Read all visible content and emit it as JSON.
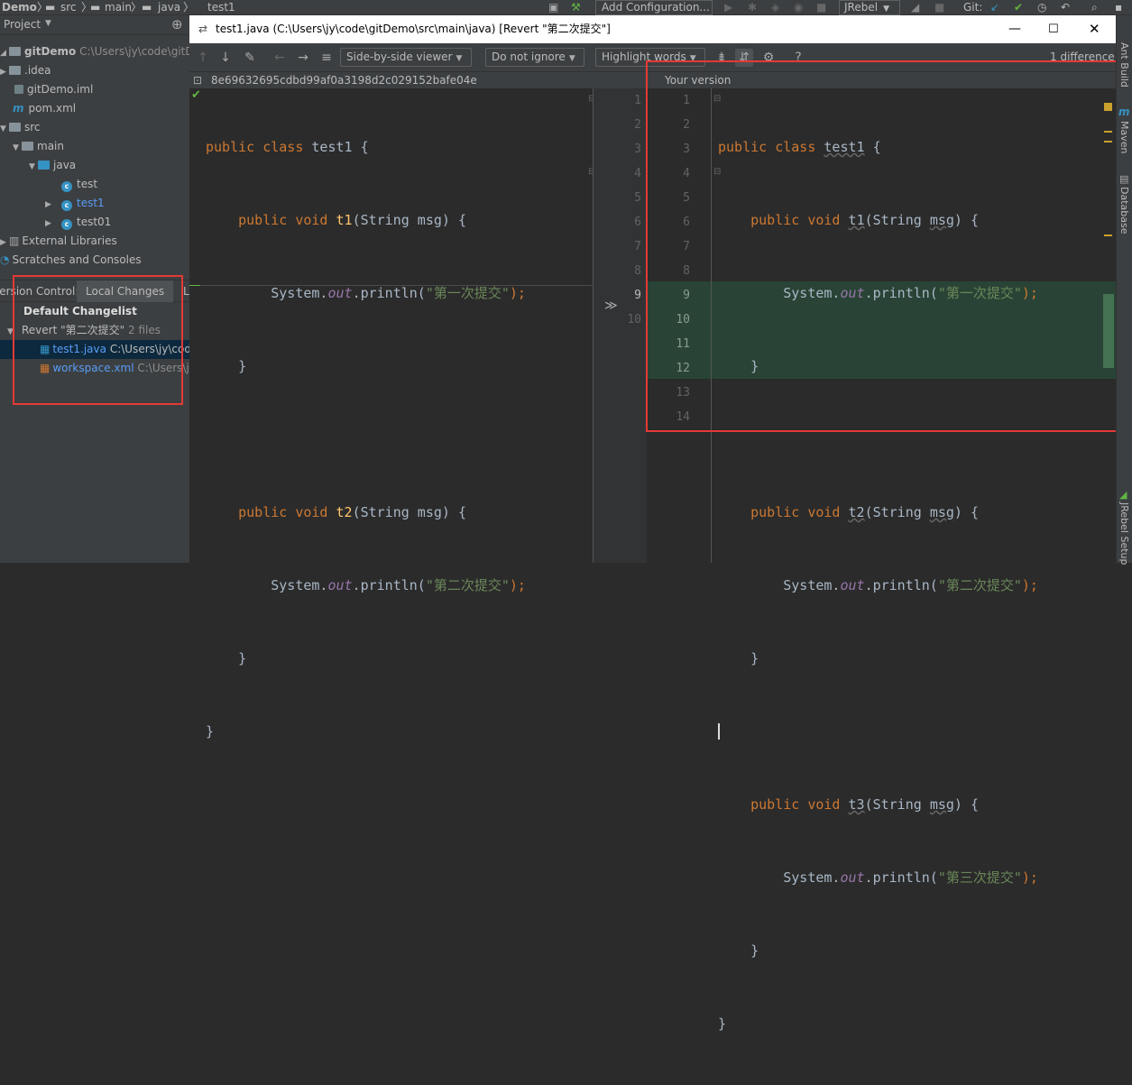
{
  "ide": {
    "breadcrumbs": [
      "Demo",
      "src",
      "main",
      "java",
      "test1"
    ],
    "run_config": "Add Configuration...",
    "jrebel": "JRebel",
    "git_label": "Git:"
  },
  "project": {
    "title": "Project",
    "tree": [
      {
        "label": "gitDemo",
        "path": "C:\\Users\\jy\\code\\gitDemo"
      },
      {
        "label": ".idea"
      },
      {
        "label": "gitDemo.iml"
      },
      {
        "label": "pom.xml"
      },
      {
        "label": "src"
      },
      {
        "label": "main"
      },
      {
        "label": "java"
      },
      {
        "label": "test"
      },
      {
        "label": "test1"
      },
      {
        "label": "test01"
      },
      {
        "label": "External Libraries"
      },
      {
        "label": "Scratches and Consoles"
      }
    ]
  },
  "vcs": {
    "tab_vc": "Version Control:",
    "tab_local": "Local Changes",
    "tab_l": "L",
    "changelist": "Default Changelist",
    "revert_label": "Revert \"第二次提交\"",
    "files_count": "2 files",
    "files": [
      {
        "name": "test1.java",
        "path": "C:\\Users\\jy\\code"
      },
      {
        "name": "workspace.xml",
        "path": "C:\\Users\\j"
      }
    ]
  },
  "dialog": {
    "title": "test1.java (C:\\Users\\jy\\code\\gitDemo\\src\\main\\java) [Revert \"第二次提交\"]",
    "viewer": "Side-by-side viewer",
    "ignore": "Do not ignore",
    "highlight": "Highlight words",
    "diff_count": "1 difference",
    "left_header": "8e69632695cdbd99af0a3198d2c029152bafe04e",
    "right_header": "Your version",
    "gutter_marker": "9",
    "left_line_numbers": [
      "1",
      "2",
      "3",
      "4",
      "5",
      "6",
      "7",
      "8",
      "9",
      "10"
    ],
    "right_line_numbers": [
      "1",
      "2",
      "3",
      "4",
      "5",
      "6",
      "7",
      "8",
      "9",
      "10",
      "11",
      "12",
      "13",
      "14"
    ]
  },
  "code": {
    "class_kw": "public class",
    "class_left": "test1",
    "class_right": "test1",
    "method_kw": "public void",
    "sig_tail": "(String msg) {",
    "sig_tail_r1": "(String ",
    "sig_tail_r2": "msg",
    "sig_tail_r3": ") {",
    "sysout1": "System.",
    "out": "out",
    "println": ".println(",
    "close": ");",
    "m1": "t1",
    "m2": "t2",
    "m3": "t3",
    "s1": "\"第一次提交\"",
    "s2": "\"第二次提交\"",
    "s3": "\"第三次提交\"",
    "brace_close": "}",
    "brace_open": "{"
  },
  "sidebar_right": {
    "ant": "Ant Build",
    "maven": "Maven",
    "database": "Database",
    "jrebel_setup": "JRebel Setup"
  },
  "colors": {
    "added_bg": "#294436",
    "highlight_box": "#e53935"
  }
}
